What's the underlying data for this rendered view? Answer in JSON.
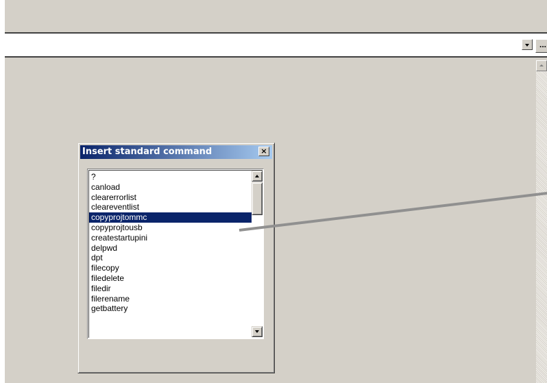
{
  "command_bar": {
    "value": "",
    "browse_label": "..."
  },
  "dialog": {
    "title": "Insert standard command",
    "close_label": "×",
    "items": [
      "?",
      "canload",
      "clearerrorlist",
      "cleareventlist",
      "copyprojtommc",
      "copyprojtousb",
      "createstartupini",
      "delpwd",
      "dpt",
      "filecopy",
      "filedelete",
      "filedir",
      "filerename",
      "getbattery"
    ],
    "selected_item": "copyprojtommc"
  },
  "icons": {
    "combo_arrow": "chevron-down-icon",
    "close": "close-icon",
    "scroll_up": "arrow-up-icon",
    "scroll_down": "arrow-down-icon"
  },
  "colors": {
    "selection": "#0a246a",
    "title_gradient_start": "#0a246a",
    "title_gradient_end": "#a6caf0",
    "pointer": "#909090"
  }
}
